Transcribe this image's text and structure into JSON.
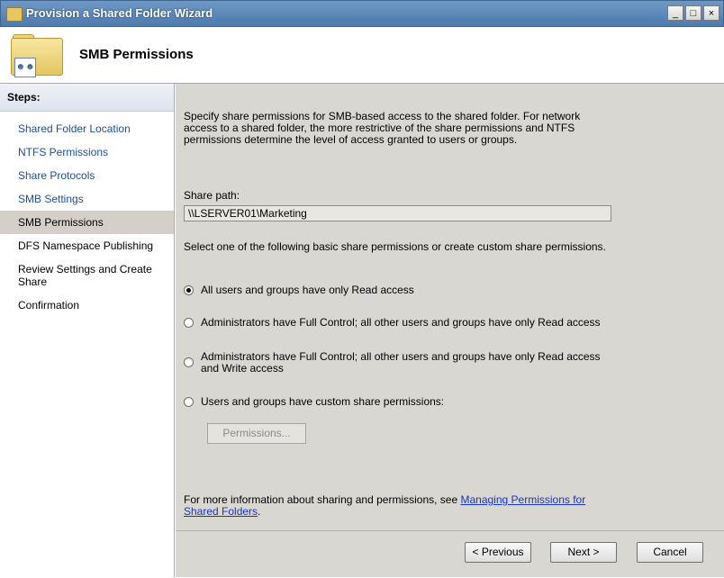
{
  "window": {
    "title": "Provision a Shared Folder Wizard",
    "min_label": "_",
    "max_label": "□",
    "close_label": "×"
  },
  "header": {
    "title": "SMB Permissions",
    "icon": "shared-folder-icon"
  },
  "steps": {
    "heading": "Steps:",
    "items": [
      {
        "label": "Shared Folder Location",
        "state": "done"
      },
      {
        "label": "NTFS Permissions",
        "state": "done"
      },
      {
        "label": "Share Protocols",
        "state": "done"
      },
      {
        "label": "SMB Settings",
        "state": "done"
      },
      {
        "label": "SMB Permissions",
        "state": "current"
      },
      {
        "label": "DFS Namespace Publishing",
        "state": "pending"
      },
      {
        "label": "Review Settings and Create Share",
        "state": "pending"
      },
      {
        "label": "Confirmation",
        "state": "pending"
      }
    ]
  },
  "content": {
    "intro": "Specify share permissions for SMB-based access to the shared folder. For network access to a shared folder, the more restrictive of the share permissions and NTFS permissions determine the level of access granted to users or groups.",
    "share_path_label": "Share path:",
    "share_path_value": "\\\\LSERVER01\\Marketing",
    "select_hint": "Select one of the following basic share permissions or create custom share permissions.",
    "options": [
      {
        "label": "All users and groups have only Read access",
        "selected": true
      },
      {
        "label": "Administrators have Full Control; all other users and groups have only Read access",
        "selected": false
      },
      {
        "label": "Administrators have Full Control; all other users and groups have only Read access and Write access",
        "selected": false
      },
      {
        "label": "Users and groups have custom share permissions:",
        "selected": false
      }
    ],
    "permissions_button": "Permissions...",
    "more_info_text": "For more information about sharing and permissions, see ",
    "more_info_link": "Managing Permissions for Shared Folders",
    "more_info_end": "."
  },
  "buttons": {
    "previous": "< Previous",
    "next": "Next >",
    "cancel": "Cancel"
  },
  "colors": {
    "link": "#1a4fa3",
    "titlebar": "#4d7aac",
    "content_bg": "#d8d7d2"
  }
}
